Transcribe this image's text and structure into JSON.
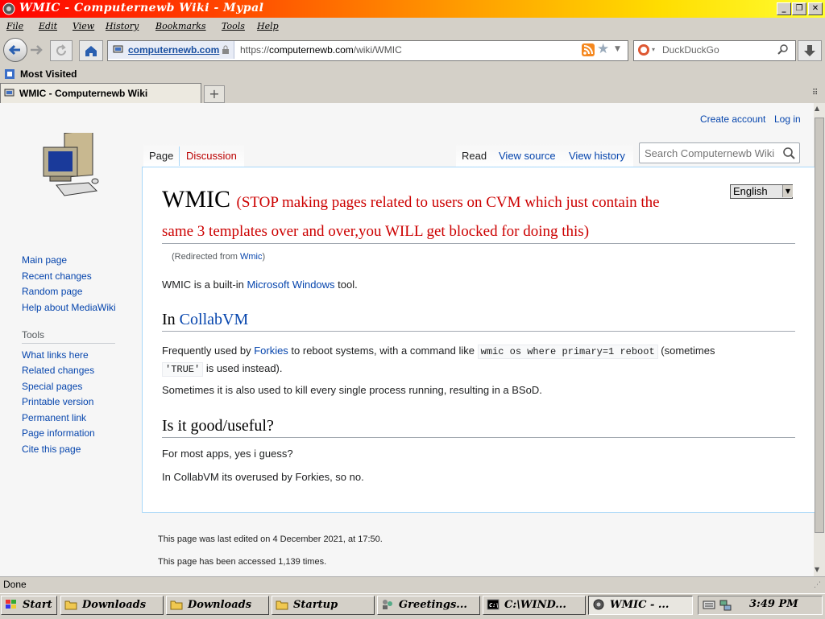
{
  "window": {
    "title": "WMIC - Computernewb Wiki - Mypal"
  },
  "menu": [
    "File",
    "Edit",
    "View",
    "History",
    "Bookmarks",
    "Tools",
    "Help"
  ],
  "nav": {
    "identity": "computernewb.com",
    "url_prefix": "https://",
    "url_host": "computernewb.com",
    "url_path": "/wiki/WMIC",
    "search_engine": "DuckDuckGo"
  },
  "bookmarks": {
    "most_visited": "Most Visited"
  },
  "tabs": [
    {
      "label": "WMIC - Computernewb Wiki"
    }
  ],
  "wiki": {
    "create_account": "Create account",
    "log_in": "Log in",
    "tab_page": "Page",
    "tab_discussion": "Discussion",
    "tab_read": "Read",
    "tab_view_source": "View source",
    "tab_view_history": "View history",
    "search_placeholder": "Search Computernewb Wiki",
    "language": "English",
    "nav_links": [
      "Main page",
      "Recent changes",
      "Random page",
      "Help about MediaWiki"
    ],
    "tools_heading": "Tools",
    "tools_links": [
      "What links here",
      "Related changes",
      "Special pages",
      "Printable version",
      "Permanent link",
      "Page information",
      "Cite this page"
    ],
    "title": "WMIC",
    "title_note_line1": "(STOP making pages related to users on CVM which just contain the",
    "title_note_line2": "same 3 templates over and over,you WILL get blocked for doing this)",
    "redirected_prefix": "(Redirected from ",
    "redirected_link": "Wmic",
    "redirected_suffix": ")",
    "intro_pre": "WMIC is a built-in ",
    "intro_link": "Microsoft Windows",
    "intro_post": " tool.",
    "h2_collabvm_prefix": "In ",
    "h2_collabvm_link": "CollabVM",
    "p1_pre": "Frequently used by ",
    "p1_link": "Forkies",
    "p1_mid": " to reboot systems, with a command like ",
    "p1_code": "wmic os where primary=1 reboot",
    "p1_post": " (sometimes",
    "p1_code2": "'TRUE'",
    "p1_end": " is used instead).",
    "p2": "Sometimes it is also used to kill every single process running, resulting in a BSoD.",
    "h2_good": "Is it good/useful?",
    "p3": "For most apps, yes i guess?",
    "p4": "In CollabVM its overused by Forkies, so no.",
    "footer_edited": "This page was last edited on 4 December 2021, at 17:50.",
    "footer_accessed": "This page has been accessed 1,139 times."
  },
  "status": "Done",
  "taskbar": {
    "start": "Start",
    "buttons": [
      "Downloads",
      "Downloads",
      "Startup",
      "Greetings...",
      "C:\\WIND...",
      "WMIC - ..."
    ],
    "clock": "3:49 PM"
  }
}
